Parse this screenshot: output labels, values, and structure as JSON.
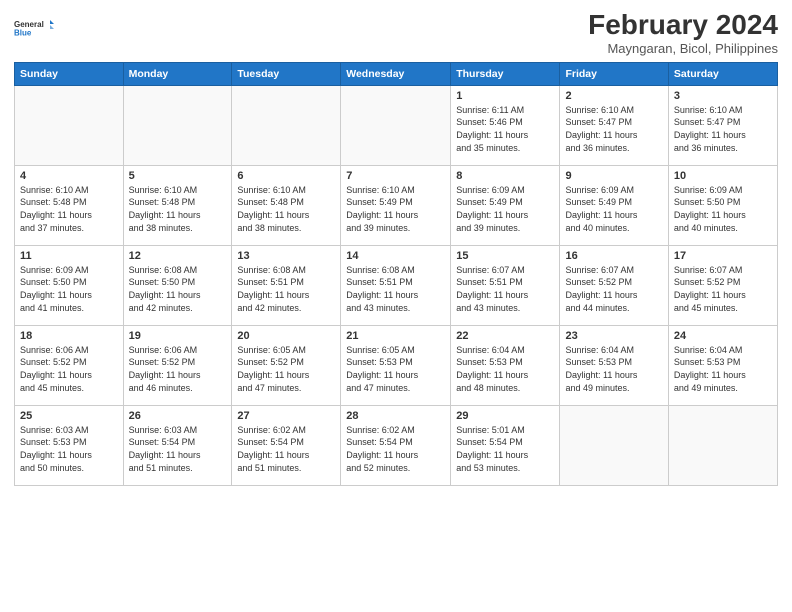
{
  "logo": {
    "line1": "General",
    "line2": "Blue"
  },
  "title": "February 2024",
  "subtitle": "Mayngaran, Bicol, Philippines",
  "days_of_week": [
    "Sunday",
    "Monday",
    "Tuesday",
    "Wednesday",
    "Thursday",
    "Friday",
    "Saturday"
  ],
  "weeks": [
    [
      {
        "day": "",
        "info": ""
      },
      {
        "day": "",
        "info": ""
      },
      {
        "day": "",
        "info": ""
      },
      {
        "day": "",
        "info": ""
      },
      {
        "day": "1",
        "info": "Sunrise: 6:11 AM\nSunset: 5:46 PM\nDaylight: 11 hours\nand 35 minutes."
      },
      {
        "day": "2",
        "info": "Sunrise: 6:10 AM\nSunset: 5:47 PM\nDaylight: 11 hours\nand 36 minutes."
      },
      {
        "day": "3",
        "info": "Sunrise: 6:10 AM\nSunset: 5:47 PM\nDaylight: 11 hours\nand 36 minutes."
      }
    ],
    [
      {
        "day": "4",
        "info": "Sunrise: 6:10 AM\nSunset: 5:48 PM\nDaylight: 11 hours\nand 37 minutes."
      },
      {
        "day": "5",
        "info": "Sunrise: 6:10 AM\nSunset: 5:48 PM\nDaylight: 11 hours\nand 38 minutes."
      },
      {
        "day": "6",
        "info": "Sunrise: 6:10 AM\nSunset: 5:48 PM\nDaylight: 11 hours\nand 38 minutes."
      },
      {
        "day": "7",
        "info": "Sunrise: 6:10 AM\nSunset: 5:49 PM\nDaylight: 11 hours\nand 39 minutes."
      },
      {
        "day": "8",
        "info": "Sunrise: 6:09 AM\nSunset: 5:49 PM\nDaylight: 11 hours\nand 39 minutes."
      },
      {
        "day": "9",
        "info": "Sunrise: 6:09 AM\nSunset: 5:49 PM\nDaylight: 11 hours\nand 40 minutes."
      },
      {
        "day": "10",
        "info": "Sunrise: 6:09 AM\nSunset: 5:50 PM\nDaylight: 11 hours\nand 40 minutes."
      }
    ],
    [
      {
        "day": "11",
        "info": "Sunrise: 6:09 AM\nSunset: 5:50 PM\nDaylight: 11 hours\nand 41 minutes."
      },
      {
        "day": "12",
        "info": "Sunrise: 6:08 AM\nSunset: 5:50 PM\nDaylight: 11 hours\nand 42 minutes."
      },
      {
        "day": "13",
        "info": "Sunrise: 6:08 AM\nSunset: 5:51 PM\nDaylight: 11 hours\nand 42 minutes."
      },
      {
        "day": "14",
        "info": "Sunrise: 6:08 AM\nSunset: 5:51 PM\nDaylight: 11 hours\nand 43 minutes."
      },
      {
        "day": "15",
        "info": "Sunrise: 6:07 AM\nSunset: 5:51 PM\nDaylight: 11 hours\nand 43 minutes."
      },
      {
        "day": "16",
        "info": "Sunrise: 6:07 AM\nSunset: 5:52 PM\nDaylight: 11 hours\nand 44 minutes."
      },
      {
        "day": "17",
        "info": "Sunrise: 6:07 AM\nSunset: 5:52 PM\nDaylight: 11 hours\nand 45 minutes."
      }
    ],
    [
      {
        "day": "18",
        "info": "Sunrise: 6:06 AM\nSunset: 5:52 PM\nDaylight: 11 hours\nand 45 minutes."
      },
      {
        "day": "19",
        "info": "Sunrise: 6:06 AM\nSunset: 5:52 PM\nDaylight: 11 hours\nand 46 minutes."
      },
      {
        "day": "20",
        "info": "Sunrise: 6:05 AM\nSunset: 5:52 PM\nDaylight: 11 hours\nand 47 minutes."
      },
      {
        "day": "21",
        "info": "Sunrise: 6:05 AM\nSunset: 5:53 PM\nDaylight: 11 hours\nand 47 minutes."
      },
      {
        "day": "22",
        "info": "Sunrise: 6:04 AM\nSunset: 5:53 PM\nDaylight: 11 hours\nand 48 minutes."
      },
      {
        "day": "23",
        "info": "Sunrise: 6:04 AM\nSunset: 5:53 PM\nDaylight: 11 hours\nand 49 minutes."
      },
      {
        "day": "24",
        "info": "Sunrise: 6:04 AM\nSunset: 5:53 PM\nDaylight: 11 hours\nand 49 minutes."
      }
    ],
    [
      {
        "day": "25",
        "info": "Sunrise: 6:03 AM\nSunset: 5:53 PM\nDaylight: 11 hours\nand 50 minutes."
      },
      {
        "day": "26",
        "info": "Sunrise: 6:03 AM\nSunset: 5:54 PM\nDaylight: 11 hours\nand 51 minutes."
      },
      {
        "day": "27",
        "info": "Sunrise: 6:02 AM\nSunset: 5:54 PM\nDaylight: 11 hours\nand 51 minutes."
      },
      {
        "day": "28",
        "info": "Sunrise: 6:02 AM\nSunset: 5:54 PM\nDaylight: 11 hours\nand 52 minutes."
      },
      {
        "day": "29",
        "info": "Sunrise: 5:01 AM\nSunset: 5:54 PM\nDaylight: 11 hours\nand 53 minutes."
      },
      {
        "day": "",
        "info": ""
      },
      {
        "day": "",
        "info": ""
      }
    ]
  ]
}
